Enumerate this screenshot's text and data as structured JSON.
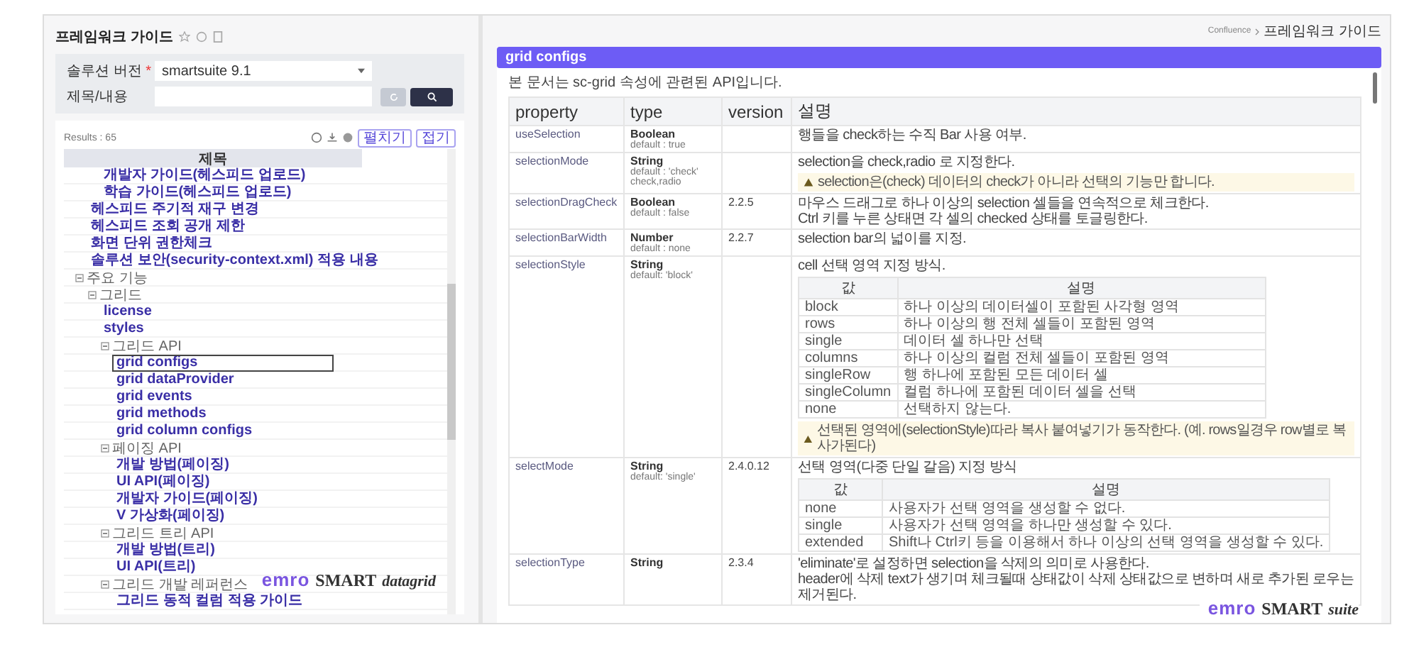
{
  "page": {
    "title": "프레임워크 가이드"
  },
  "filter": {
    "fields": [
      {
        "label": "솔루션 버전",
        "required_mark": "*",
        "kind": "select",
        "value": "smartsuite 9.1"
      },
      {
        "label": "제목/내용",
        "kind": "text"
      }
    ]
  },
  "results": {
    "count": "Results : 65",
    "buttons": [
      "펼치기",
      "접기"
    ],
    "column": "제목",
    "tree": [
      {
        "children": [
          {
            "children": [
              {
                "label": "개발자 가이드(헤스피드 업로드)",
                "kind": "link",
                "selected": false
              },
              {
                "label": "학습 가이드(헤스피드 업로드)",
                "kind": "link",
                "selected": false
              }
            ]
          },
          {
            "label": "헤스피드 주기적 재구 변경",
            "kind": "link",
            "selected": false
          },
          {
            "label": "헤스피드 조회 공개 제한",
            "kind": "link",
            "selected": false
          },
          {
            "label": "화면 단위 권한체크",
            "kind": "link",
            "selected": false
          },
          {
            "label": "솔루션 보안(security-context.xml) 적용 내용",
            "kind": "link",
            "selected": false
          }
        ]
      },
      {
        "label": "주요 기능",
        "kind": "folder",
        "expanded": true,
        "children": [
          {
            "label": "그리드",
            "kind": "folder",
            "expanded": true,
            "children": [
              {
                "label": "license",
                "kind": "link",
                "selected": false
              },
              {
                "label": "styles",
                "kind": "link",
                "selected": false
              },
              {
                "label": "그리드 API",
                "kind": "folder",
                "expanded": true,
                "children": [
                  {
                    "label": "grid configs",
                    "kind": "link",
                    "selected": true
                  },
                  {
                    "label": "grid dataProvider",
                    "kind": "link",
                    "selected": false
                  },
                  {
                    "label": "grid events",
                    "kind": "link",
                    "selected": false
                  },
                  {
                    "label": "grid methods",
                    "kind": "link",
                    "selected": false
                  },
                  {
                    "label": "grid column configs",
                    "kind": "link",
                    "selected": false
                  }
                ]
              },
              {
                "label": "페이징 API",
                "kind": "folder",
                "expanded": true,
                "children": [
                  {
                    "label": "개발 방법(페이징)",
                    "kind": "link",
                    "selected": false
                  },
                  {
                    "label": "UI API(페이징)",
                    "kind": "link",
                    "selected": false
                  },
                  {
                    "label": "개발자 가이드(페이징)",
                    "kind": "link",
                    "selected": false
                  },
                  {
                    "label": "V 가상화(페이징)",
                    "kind": "link",
                    "selected": false
                  }
                ]
              },
              {
                "label": "그리드 트리 API",
                "kind": "folder",
                "expanded": true,
                "children": [
                  {
                    "label": "개발 방법(트리)",
                    "kind": "link",
                    "selected": false
                  },
                  {
                    "label": "UI API(트리)",
                    "kind": "link",
                    "selected": false
                  }
                ]
              },
              {
                "label": "그리드 개발 레퍼런스",
                "kind": "folder",
                "expanded": true,
                "children": [
                  {
                    "label": "그리드 동적 컬럼 적용 가이드",
                    "kind": "link",
                    "selected": false
                  }
                ]
              }
            ]
          }
        ]
      }
    ],
    "logo": {
      "brand": "emro",
      "product": "SMART",
      "edition": "datagrid"
    }
  },
  "breadcrumb": [
    "Confluence",
    "프레임워크 가이드"
  ],
  "doc": {
    "title": "grid configs",
    "intro": "본 문서는 sc-grid 속성에 관련된 API입니다.",
    "columns": [
      "property",
      "type",
      "version",
      "설명"
    ],
    "rows": [
      {
        "property": "useSelection",
        "type": "Boolean",
        "type_notes": [
          "default : true"
        ],
        "desc": [
          "행들을 check하는 수직 Bar 사용 여부."
        ]
      },
      {
        "property": "selectionMode",
        "type": "String",
        "type_notes": [
          "default : 'check'",
          "check,radio"
        ],
        "desc": [
          "selection을 check,radio 로 지정한다."
        ],
        "note": "selection은(check) 데이터의 check가 아니라 선택의 기능만 합니다."
      },
      {
        "property": "selectionDragCheck",
        "type": "Boolean",
        "type_notes": [
          "default : false"
        ],
        "version": "2.2.5",
        "desc": [
          "마우스 드래그로 하나 이상의 selection 셀들을 연속적으로 체크한다.",
          "Ctrl 키를 누른 상태면 각 셀의 checked 상태를 토글링한다."
        ]
      },
      {
        "property": "selectionBarWidth",
        "type": "Number",
        "type_notes": [
          "default : none"
        ],
        "version": "2.2.7",
        "desc": [
          "selection bar의 넓이를 지정."
        ]
      },
      {
        "property": "selectionStyle",
        "type": "String",
        "type_notes": [
          "default: 'block'"
        ],
        "desc": [
          "cell 선택 영역 지정 방식."
        ],
        "subtable": {
          "columns": [
            "값",
            "설명"
          ],
          "rows": [
            [
              "block",
              "하나 이상의 데이터셀이 포함된 사각형 영역"
            ],
            [
              "rows",
              "하나 이상의 행 전체 셀들이 포함된 영역"
            ],
            [
              "single",
              "데이터 셀 하나만 선택"
            ],
            [
              "columns",
              "하나 이상의 컬럼 전체 셀들이 포함된 영역"
            ],
            [
              "singleRow",
              "행 하나에 포함된 모든 데이터 셀"
            ],
            [
              "singleColumn",
              "컬럼 하나에 포함된 데이터 셀을 선택"
            ],
            [
              "none",
              "선택하지 않는다."
            ]
          ]
        },
        "note": "선택된 영역에(selectionStyle)따라 복사 붙여넣기가 동작한다. (예. rows일경우 row별로 복사가된다)"
      },
      {
        "property": "selectMode",
        "type": "String",
        "type_notes": [
          "default: 'single'"
        ],
        "version": "2.4.0.12",
        "desc": [
          "선택 영역(다중 단일 갈음) 지정 방식"
        ],
        "subtable": {
          "columns": [
            "값",
            "설명"
          ],
          "rows": [
            [
              "none",
              "사용자가 선택 영역을 생성할 수 없다."
            ],
            [
              "single",
              "사용자가 선택 영역을 하나만 생성할 수 있다."
            ],
            [
              "extended",
              "Shift나 Ctrl키 등을 이용해서 하나 이상의 선택 영역을 생성할 수 있다."
            ]
          ]
        }
      },
      {
        "property": "selectionType",
        "type": "String",
        "version": "2.3.4",
        "desc": [
          "'eliminate'로 설정하면 selection을 삭제의 의미로 사용한다.",
          "header에 삭제 text가 생기며 체크될때 상태값이 삭제 상태값으로 변하며 새로 추가된 로우는 제거된다."
        ]
      }
    ],
    "logo": {
      "brand": "emro",
      "product": "SMART",
      "edition": "suite"
    }
  }
}
